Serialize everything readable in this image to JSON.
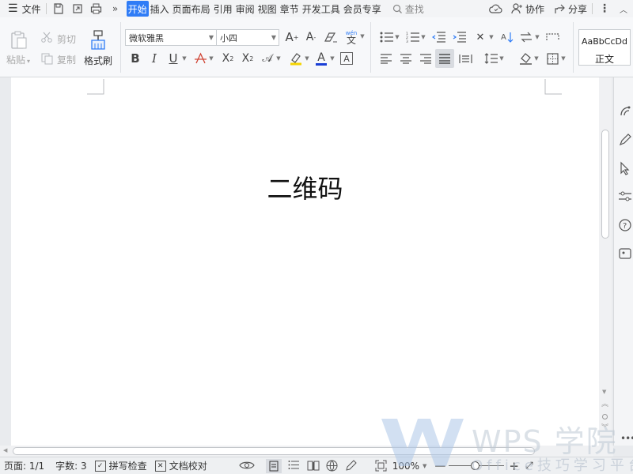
{
  "menubar": {
    "file_label": "文件",
    "tabs": [
      {
        "label": "开始",
        "active": true
      },
      {
        "label": "插入"
      },
      {
        "label": "页面布局"
      },
      {
        "label": "引用"
      },
      {
        "label": "审阅"
      },
      {
        "label": "视图"
      },
      {
        "label": "章节"
      },
      {
        "label": "开发工具"
      },
      {
        "label": "会员专享"
      }
    ],
    "search_label": "查找",
    "collab_label": "协作",
    "share_label": "分享"
  },
  "ribbon": {
    "paste_label": "粘贴",
    "cut_label": "剪切",
    "copy_label": "复制",
    "format_painter_label": "格式刷",
    "font_name": "微软雅黑",
    "font_size": "小四",
    "style_preview": "AaBbCcDd",
    "style_name": "正文"
  },
  "document": {
    "title_text": "二维码"
  },
  "statusbar": {
    "page_info": "页面: 1/1",
    "word_count": "字数: 3",
    "spell_check_label": "拼写检查",
    "proofread_label": "文档校对",
    "zoom_level": "100%"
  },
  "watermark": {
    "brand": "WPS 学院",
    "subtitle": "Office技巧学习平台"
  },
  "colors": {
    "accent": "#2f7cf6",
    "font_color_bar": "#1a3fd6",
    "highlight_bar": "#f5d400",
    "text_color_bar": "#e04a3a"
  }
}
